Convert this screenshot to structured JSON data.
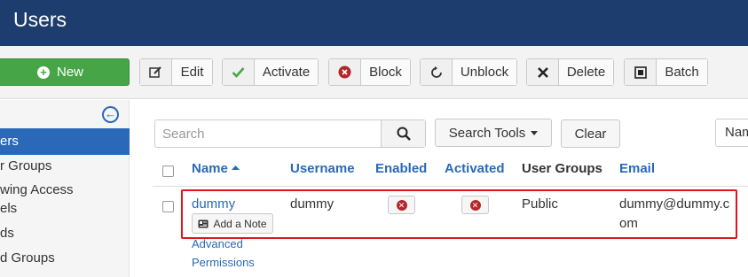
{
  "header": {
    "title": "Users"
  },
  "toolbar": {
    "new_label": "New",
    "edit_label": "Edit",
    "activate_label": "Activate",
    "block_label": "Block",
    "unblock_label": "Unblock",
    "delete_label": "Delete",
    "batch_label": "Batch"
  },
  "sidebar": {
    "active_item": "ers",
    "items": [
      {
        "label": "r Groups"
      },
      {
        "label": "wing Access"
      },
      {
        "label": "els"
      },
      {
        "label": "ds"
      },
      {
        "label": "d Groups"
      }
    ]
  },
  "filters": {
    "search_placeholder": "Search",
    "search_value": "",
    "search_tools_label": "Search Tools",
    "clear_label": "Clear",
    "sort_value": "Nam"
  },
  "table": {
    "columns": [
      "Name",
      "Username",
      "Enabled",
      "Activated",
      "User Groups",
      "Email"
    ],
    "rows": [
      {
        "name": "dummy",
        "username": "dummy",
        "user_groups": "Public",
        "email": "dummy@dummy.com",
        "add_note_label": "Add a Note",
        "advanced_label": "Advanced",
        "permissions_label": "Permissions"
      }
    ]
  },
  "colors": {
    "header_bg": "#1c3d6e",
    "new_button": "#46a546",
    "link": "#2a69b8",
    "status_red": "#b4262a",
    "highlight": "#e0161f"
  },
  "icons": {
    "new": "plus-circle-icon",
    "edit": "edit-icon",
    "activate": "checkmark-icon",
    "block": "block-icon",
    "unblock": "refresh-icon",
    "delete": "close-icon",
    "batch": "batch-icon",
    "sidebar_collapse": "arrow-left-circle-icon",
    "search": "search-icon",
    "note": "note-icon",
    "status": "x-circle-icon"
  }
}
